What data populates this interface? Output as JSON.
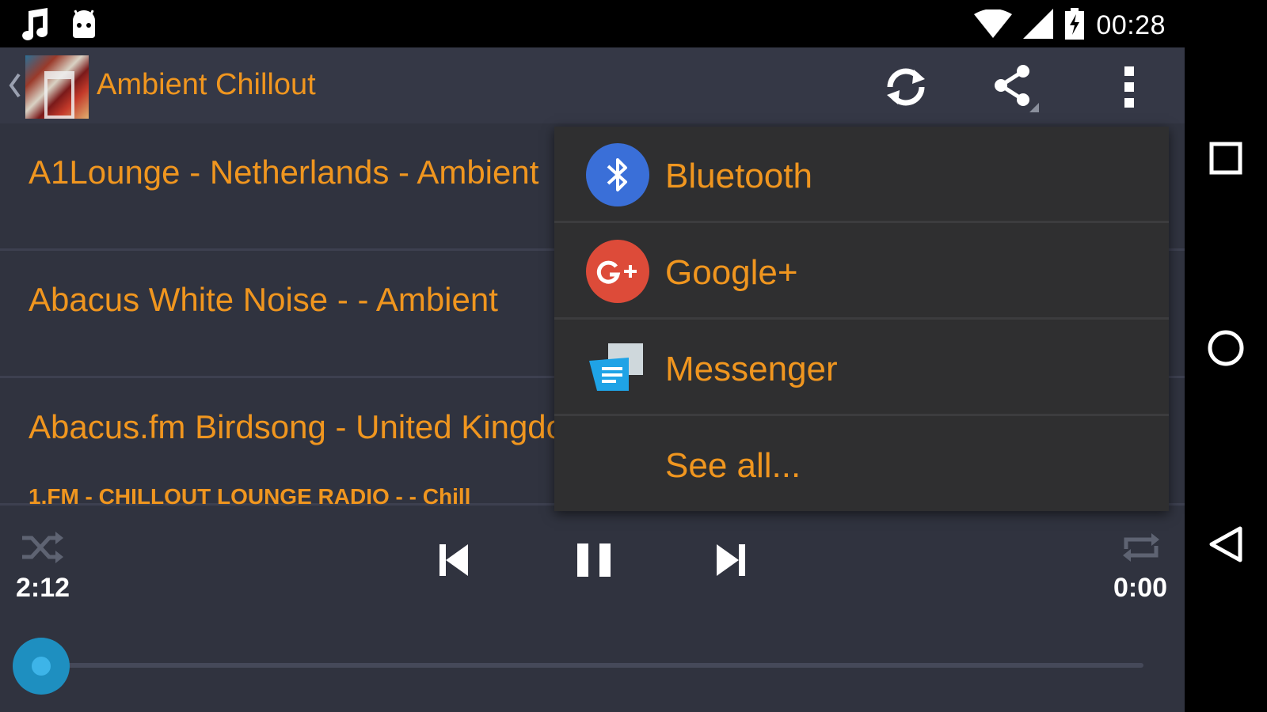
{
  "status_bar": {
    "time": "00:28",
    "icons": [
      "music-note-icon",
      "android-icon",
      "wifi-icon",
      "cell-signal-icon",
      "battery-charging-icon"
    ]
  },
  "action_bar": {
    "title": "Ambient Chillout",
    "actions": [
      "refresh-icon",
      "share-icon",
      "overflow-menu-icon"
    ]
  },
  "stations": [
    {
      "label": "A1Lounge - Netherlands - Ambient"
    },
    {
      "label": "Abacus White Noise - - Ambient"
    },
    {
      "label": "Abacus.fm Birdsong - United Kingdom"
    }
  ],
  "player": {
    "now_playing": "1.FM - CHILLOUT LOUNGE RADIO - - Chill",
    "elapsed": "2:12",
    "duration": "0:00",
    "progress": 0.0
  },
  "share_menu": {
    "items": [
      {
        "label": "Bluetooth",
        "icon": "bluetooth-icon",
        "color": "#3a6fd8"
      },
      {
        "label": "Google+",
        "icon": "google-plus-icon",
        "color": "#dd4b39"
      },
      {
        "label": "Messenger",
        "icon": "messenger-icon",
        "color": "#1fa3e6"
      },
      {
        "label": "See all...",
        "icon": ""
      }
    ]
  },
  "colors": {
    "accent": "#f0961f",
    "background": "#30333f",
    "popup": "#2f2f30"
  }
}
